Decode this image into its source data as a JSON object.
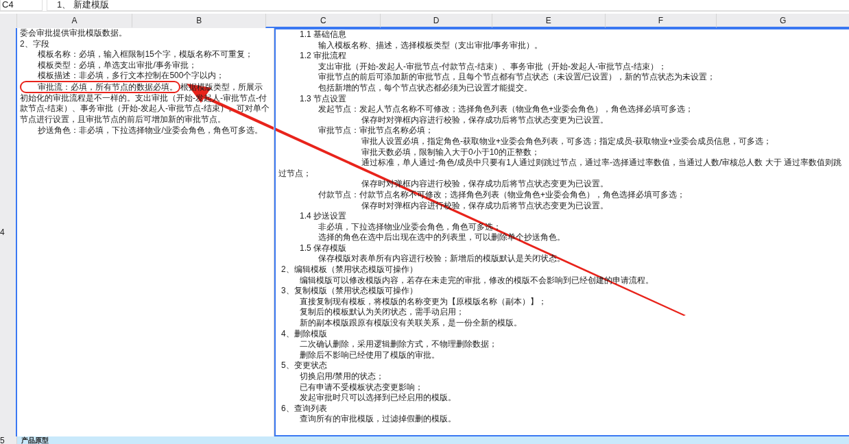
{
  "name_box": "C4",
  "formula": "1、 新建模版",
  "columns": [
    {
      "label": "A",
      "selected": false
    },
    {
      "label": "B",
      "selected": false
    },
    {
      "label": "C",
      "selected": true
    },
    {
      "label": "D",
      "selected": true
    },
    {
      "label": "E",
      "selected": true
    },
    {
      "label": "F",
      "selected": true
    },
    {
      "label": "G",
      "selected": true
    }
  ],
  "rows": [
    {
      "label": "4",
      "selected": true
    },
    {
      "label": "5",
      "selected": false,
      "cell": "产品原型"
    }
  ],
  "left_cell": [
    {
      "kind": "plain",
      "text": "委会审批提供审批模版数据。"
    },
    {
      "kind": "plain",
      "text": "2、字段"
    },
    {
      "kind": "indent",
      "text": "模板名称：必填，输入框限制15个字，模版名称不可重复；"
    },
    {
      "kind": "indent",
      "text": "模板类型：必填，单选支出审批/事务审批；"
    },
    {
      "kind": "indent",
      "text": "模板描述：非必填，多行文本控制在500个字以内；"
    },
    {
      "kind": "indent",
      "circled_text": "审批流：必填，所有节点的数据必填。",
      "text": "根据模版类型，所展示初始化的审批流程是不一样的。支出审批（开始-发起人-审批节点-付款节点-结束）、事务审批（开始-发起人-审批节点-结束）。可对单个节点进行设置，且审批节点的前后可增加新的审批节点。"
    },
    {
      "kind": "indent",
      "text": "抄送角色：非必填，下拉选择物业/业委会角色，角色可多选。"
    }
  ],
  "selected_cell": {
    "selected": true,
    "subsections": [
      {
        "title": "1.1 基础信息",
        "lines": [
          "输入模板名称、描述，选择模板类型（支出审批/事务审批）。"
        ]
      },
      {
        "title": "1.2 审批流程",
        "lines": [
          "支出审批（开始-发起人-审批节点-付款节点-结束）、事务审批（开始-发起人-审批节点-结束）；",
          "审批节点的前后可添加新的审批节点，且每个节点都有节点状态（未设置/已设置），新的节点状态为未设置；",
          "包括新增的节点，每个节点状态都必须为已设置才能提交。"
        ]
      },
      {
        "title": "1.3 节点设置",
        "nodes": [
          {
            "label": "发起节点：",
            "lines": [
              "发起人节点名称不可修改；选择角色列表（物业角色+业委会角色），角色选择必填可多选；",
              "保存时对弹框内容进行校验，保存成功后将节点状态变更为已设置。"
            ]
          },
          {
            "label": "审批节点：",
            "lines": [
              "审批节点名称必填；",
              "审批人设置必填，指定角色-获取物业+业委会角色列表，可多选；指定成员-获取物业+业委会成员信息，可多选；",
              "审批天数必填，限制输入大于0小于10的正整数；",
              "通过标准，单人通过-角色/成员中只要有1人通过则跳过节点，通过率-选择通过率数值，当通过人数/审核总人数 大于 通过率数值则跳过节点；",
              "保存时对弹框内容进行校验，保存成功后将节点状态变更为已设置。"
            ]
          },
          {
            "label": "付款节点：",
            "lines": [
              "付款节点名称不可修改；选择角色列表（物业角色+业委会角色），角色选择必填可多选；",
              "保存时对弹框内容进行校验，保存成功后将节点状态变更为已设置。"
            ]
          }
        ]
      },
      {
        "title": "1.4 抄送设置",
        "lines": [
          "非必填，下拉选择物业/业委会角色，角色可多选；",
          "选择的角色在选中后出现在选中的列表里，可以删除单个抄送角色。"
        ]
      },
      {
        "title": "1.5 保存模版",
        "lines": [
          "保存模版对表单所有内容进行校验；新增后的模版默认是关闭状态。"
        ]
      }
    ],
    "sections": [
      {
        "title": "2、编辑模板（禁用状态模版可操作）",
        "lines": [
          "编辑模版可以修改模版内容，若存在未走完的审批，修改的模版不会影响到已经创建的申请流程。"
        ]
      },
      {
        "title": "3、复制模版（禁用状态模版可操作）",
        "lines": [
          "直接复制现有模板，将模版的名称变更为【原模版名称（副本）】；",
          "复制后的模板默认为关闭状态，需手动启用；",
          "新的副本模版跟原有模版没有关联关系，是一份全新的模版。"
        ]
      },
      {
        "title": "4、删除模版",
        "lines": [
          "二次确认删除，采用逻辑删除方式，不物理删除数据；",
          "删除后不影响已经使用了模版的审批。"
        ]
      },
      {
        "title": "5、变更状态",
        "lines": [
          "切换启用/禁用的状态；",
          "已有申请不受模板状态变更影响；",
          "发起审批时只可以选择到已经启用的模版。"
        ]
      },
      {
        "title": "6、查询列表",
        "lines": [
          "查询所有的审批模版，过滤掉假删的模版。"
        ]
      }
    ]
  }
}
